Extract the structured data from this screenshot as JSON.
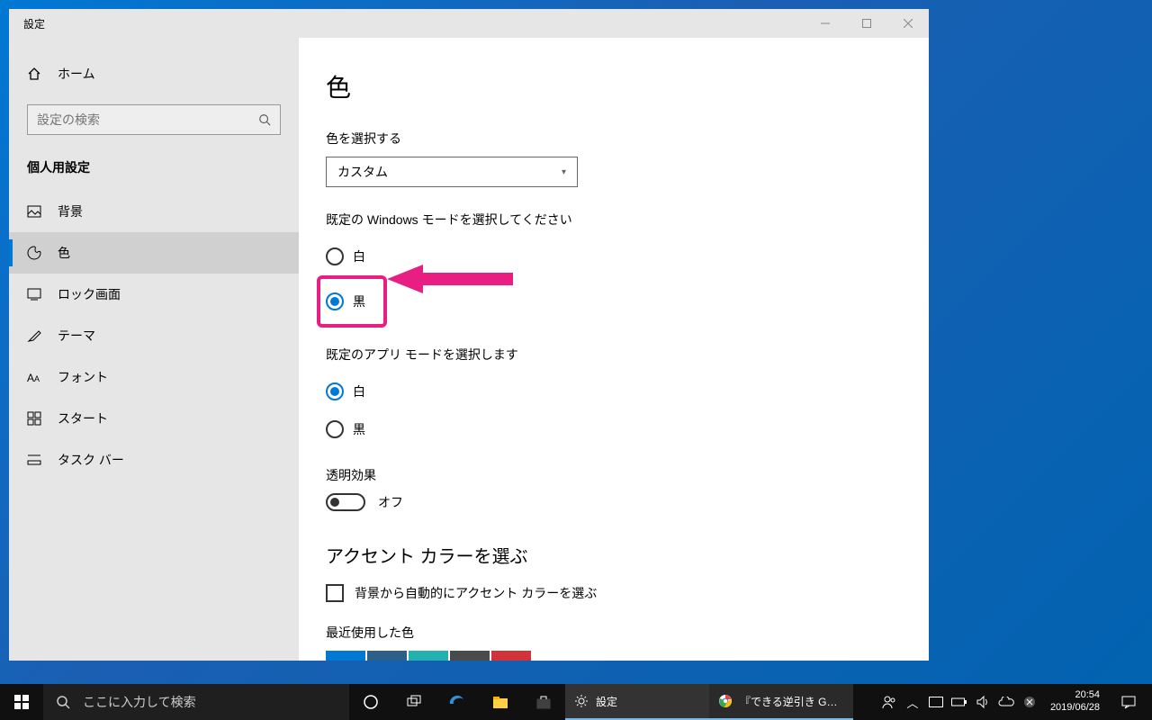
{
  "window": {
    "title": "設定",
    "controls": {
      "min": "minimize",
      "max": "maximize",
      "close": "close"
    }
  },
  "sidebar": {
    "home": "ホーム",
    "search_placeholder": "設定の検索",
    "section": "個人用設定",
    "items": [
      {
        "id": "background",
        "label": "背景"
      },
      {
        "id": "colors",
        "label": "色"
      },
      {
        "id": "lockscreen",
        "label": "ロック画面"
      },
      {
        "id": "themes",
        "label": "テーマ"
      },
      {
        "id": "fonts",
        "label": "フォント"
      },
      {
        "id": "start",
        "label": "スタート"
      },
      {
        "id": "taskbar",
        "label": "タスク バー"
      }
    ],
    "active_id": "colors"
  },
  "main": {
    "title": "色",
    "color_mode_label": "色を選択する",
    "color_mode_value": "カスタム",
    "windows_mode_label": "既定の Windows モードを選択してください",
    "windows_mode_options": {
      "light": "白",
      "dark": "黒"
    },
    "windows_mode_selected": "dark",
    "app_mode_label": "既定のアプリ モードを選択します",
    "app_mode_options": {
      "light": "白",
      "dark": "黒"
    },
    "app_mode_selected": "light",
    "transparency_label": "透明効果",
    "transparency_state": "オフ",
    "accent_section": "アクセント カラーを選ぶ",
    "auto_accent_label": "背景から自動的にアクセント カラーを選ぶ",
    "recent_colors_label": "最近使用した色",
    "recent_colors": [
      "#0078d4",
      "#2d5f8b",
      "#23b0b0",
      "#4a4a4a",
      "#d13438"
    ]
  },
  "annotation": {
    "target": "windows-mode-dark"
  },
  "taskbar": {
    "search_placeholder": "ここに入力して検索",
    "settings_label": "設定",
    "chrome_label": "『できる逆引き Goog...",
    "clock_time": "20:54",
    "clock_date": "2019/06/28"
  }
}
